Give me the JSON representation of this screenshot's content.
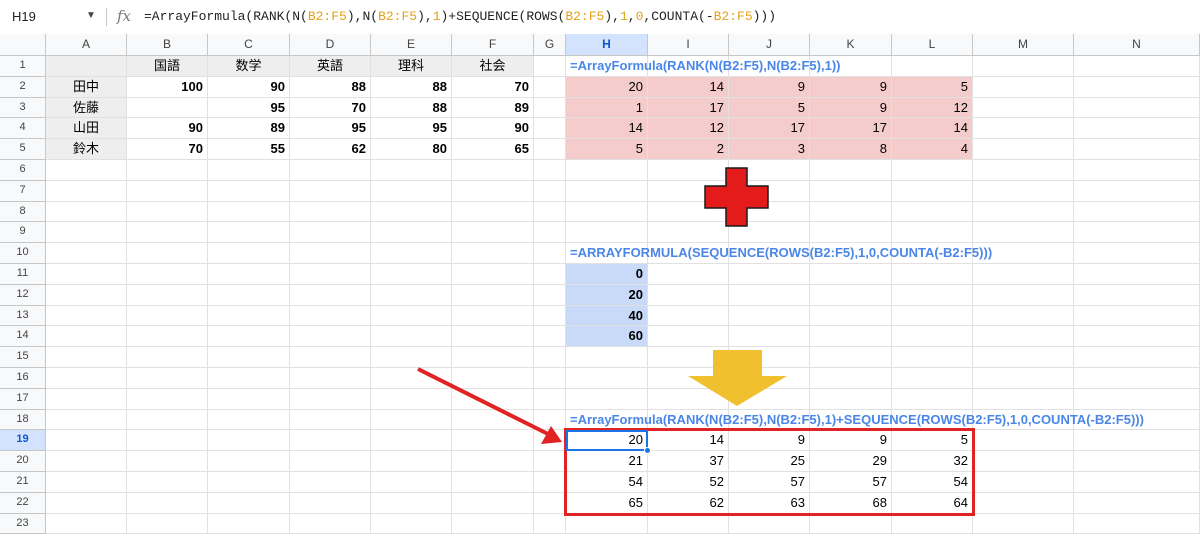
{
  "formula_bar": {
    "name_box": "H19",
    "fx_icon": "fx-icon",
    "formula": [
      {
        "t": "=ArrayFormula(RANK(N(",
        "ref": false
      },
      {
        "t": "B2:F5",
        "ref": true
      },
      {
        "t": "),N(",
        "ref": false
      },
      {
        "t": "B2:F5",
        "ref": true
      },
      {
        "t": "),",
        "ref": false
      },
      {
        "t": "1",
        "ref": true
      },
      {
        "t": ")+SEQUENCE(ROWS(",
        "ref": false
      },
      {
        "t": "B2:F5",
        "ref": true
      },
      {
        "t": "),",
        "ref": false
      },
      {
        "t": "1",
        "ref": true
      },
      {
        "t": ",",
        "ref": false
      },
      {
        "t": "0",
        "ref": true
      },
      {
        "t": ",COUNTA(-",
        "ref": false
      },
      {
        "t": "B2:F5",
        "ref": true
      },
      {
        "t": ")))",
        "ref": false
      }
    ]
  },
  "sheet": {
    "selected_cell": "H19",
    "column_headers": [
      "A",
      "B",
      "C",
      "D",
      "E",
      "F",
      "G",
      "H",
      "I",
      "J",
      "K",
      "L",
      "M",
      "N"
    ],
    "row_headers": [
      "1",
      "2",
      "3",
      "4",
      "5",
      "6",
      "7",
      "8",
      "9",
      "10",
      "11",
      "12",
      "13",
      "14",
      "15",
      "16",
      "17",
      "18",
      "19",
      "20",
      "21",
      "22",
      "23"
    ],
    "subjects": [
      "国語",
      "数学",
      "英語",
      "理科",
      "社会"
    ],
    "students": [
      {
        "name": "田中",
        "scores": [
          "100",
          "90",
          "88",
          "88",
          "70"
        ]
      },
      {
        "name": "佐藤",
        "scores": [
          "",
          "95",
          "70",
          "88",
          "89"
        ]
      },
      {
        "name": "山田",
        "scores": [
          "90",
          "89",
          "95",
          "95",
          "90"
        ]
      },
      {
        "name": "鈴木",
        "scores": [
          "70",
          "55",
          "62",
          "80",
          "65"
        ]
      }
    ],
    "rank_label": "=ArrayFormula(RANK(N(B2:F5),N(B2:F5),1))",
    "rank_values": [
      [
        "20",
        "14",
        "9",
        "9",
        "5"
      ],
      [
        "1",
        "17",
        "5",
        "9",
        "12"
      ],
      [
        "14",
        "12",
        "17",
        "17",
        "14"
      ],
      [
        "5",
        "2",
        "3",
        "8",
        "4"
      ]
    ],
    "sequence_label": "=ARRAYFORMULA(SEQUENCE(ROWS(B2:F5),1,0,COUNTA(-B2:F5)))",
    "sequence_values": [
      "0",
      "20",
      "40",
      "60"
    ],
    "result_label": "=ArrayFormula(RANK(N(B2:F5),N(B2:F5),1)+SEQUENCE(ROWS(B2:F5),1,0,COUNTA(-B2:F5)))",
    "result_values": [
      [
        "20",
        "14",
        "9",
        "9",
        "5"
      ],
      [
        "21",
        "37",
        "25",
        "29",
        "32"
      ],
      [
        "54",
        "52",
        "57",
        "57",
        "54"
      ],
      [
        "65",
        "62",
        "63",
        "68",
        "64"
      ]
    ]
  },
  "annotations": {
    "plus_icon": "red-plus-icon",
    "plus_color": "#e41b1b",
    "down_arrow_icon": "yellow-down-arrow-icon",
    "down_arrow_color": "#f0c02e",
    "pointer_arrow_icon": "red-pointer-arrow-icon",
    "pointer_arrow_color": "#e02424",
    "highlight_color": "#e02424"
  }
}
